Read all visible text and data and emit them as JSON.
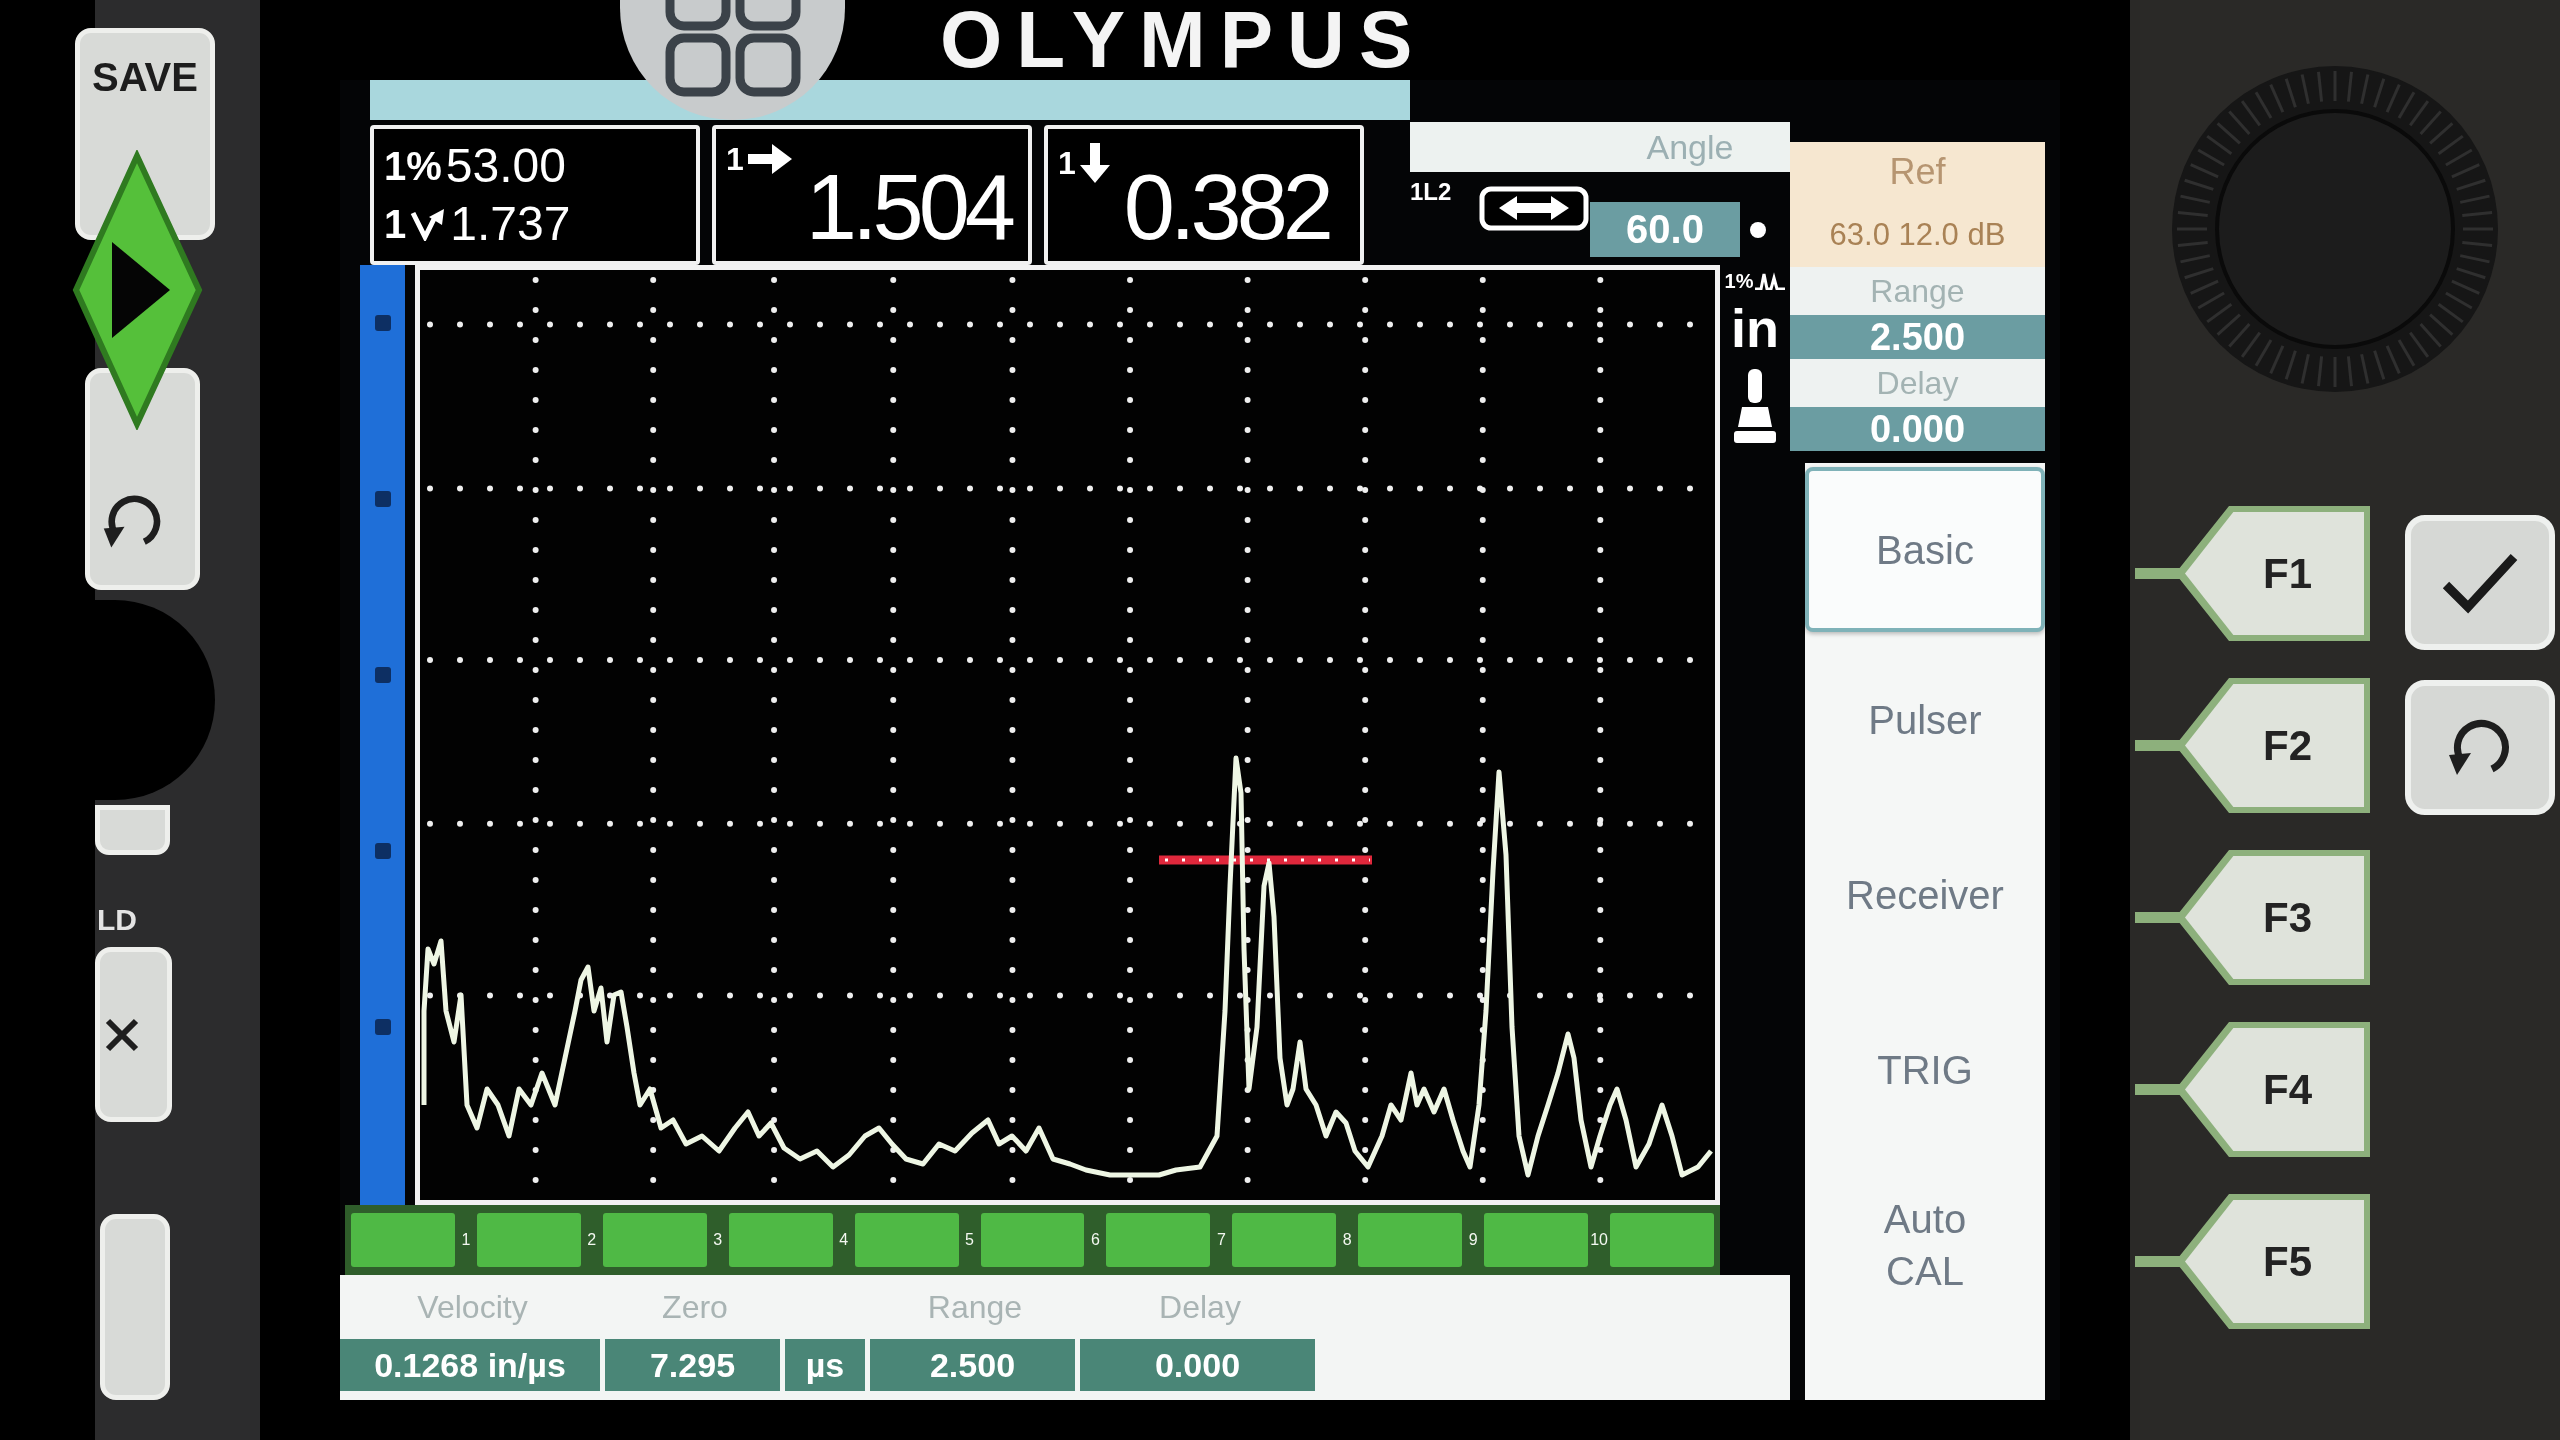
{
  "header": {
    "logo": "OLYMPUS"
  },
  "left_keys": [
    {
      "kind": "text",
      "label": "SAVE"
    },
    {
      "kind": "play"
    },
    {
      "kind": "undo"
    },
    {
      "kind": "blank"
    },
    {
      "kind": "caption",
      "label": "LD"
    },
    {
      "kind": "clear"
    },
    {
      "kind": "blank"
    }
  ],
  "readouts": [
    {
      "lines": [
        {
          "kind": "amplitude",
          "prefix": "1%",
          "value": "53.00"
        },
        {
          "kind": "soundpath",
          "prefix": "1",
          "value": "1.737"
        }
      ]
    },
    {
      "lines": [
        {
          "kind": "surface",
          "prefix": "1",
          "value": "1.504"
        }
      ]
    },
    {
      "lines": [
        {
          "kind": "depth",
          "prefix": "1",
          "value": "0.382"
        }
      ]
    }
  ],
  "leg": "1L2",
  "angle": {
    "label": "Angle",
    "value": "60.0"
  },
  "ref": {
    "label": "Ref",
    "value": "63.0 12.0 dB"
  },
  "params": [
    {
      "label": "Range",
      "value": "2.500"
    },
    {
      "label": "Delay",
      "value": "0.000"
    }
  ],
  "peak_indicator": "1%",
  "unit": "in",
  "scale_labels": [
    "1",
    "2",
    "3",
    "4",
    "5",
    "6",
    "7",
    "8",
    "9",
    "10"
  ],
  "status_bar": [
    {
      "label": "Velocity",
      "value": "0.1268 in/µs"
    },
    {
      "label": "Zero",
      "value": "7.295"
    },
    {
      "value": "µs"
    },
    {
      "label": "Range",
      "value": "2.500"
    },
    {
      "label": "Delay",
      "value": "0.000"
    }
  ],
  "menu": [
    {
      "label": "Basic",
      "selected": true
    },
    {
      "label": "Pulser",
      "selected": false
    },
    {
      "label": "Receiver",
      "selected": false
    },
    {
      "label": "TRIG",
      "selected": false
    },
    {
      "label": "Auto CAL",
      "selected": false
    }
  ],
  "function_keys": [
    "F1",
    "F2",
    "F3",
    "F4",
    "F5"
  ],
  "side_keys": [
    {
      "kind": "check"
    },
    {
      "kind": "undo"
    }
  ]
}
